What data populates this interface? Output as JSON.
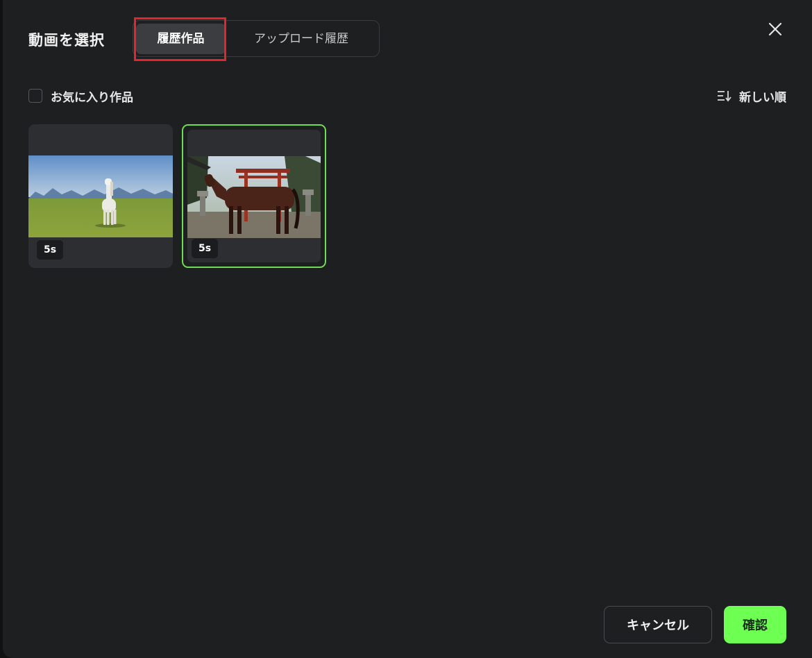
{
  "dialog": {
    "title": "動画を選択",
    "tabs": [
      {
        "label": "履歴作品",
        "active": true
      },
      {
        "label": "アップロード履歴",
        "active": false
      }
    ],
    "close_icon": "close-icon"
  },
  "filter": {
    "favorites_label": "お気に入り作品",
    "favorites_checked": false
  },
  "sort": {
    "icon": "sort-icon",
    "label": "新しい順"
  },
  "videos": [
    {
      "duration": "5s",
      "selected": false,
      "scene": "white horse standing in a green meadow with mountains"
    },
    {
      "duration": "5s",
      "selected": true,
      "scene": "brown horse in front of a red torii gate with stone lanterns"
    }
  ],
  "footer": {
    "cancel_label": "キャンセル",
    "confirm_label": "確認"
  },
  "colors": {
    "accent": "#6dff52",
    "selected_border": "#6fdd55",
    "highlight": "#e4252b",
    "background": "#1e1f21"
  }
}
